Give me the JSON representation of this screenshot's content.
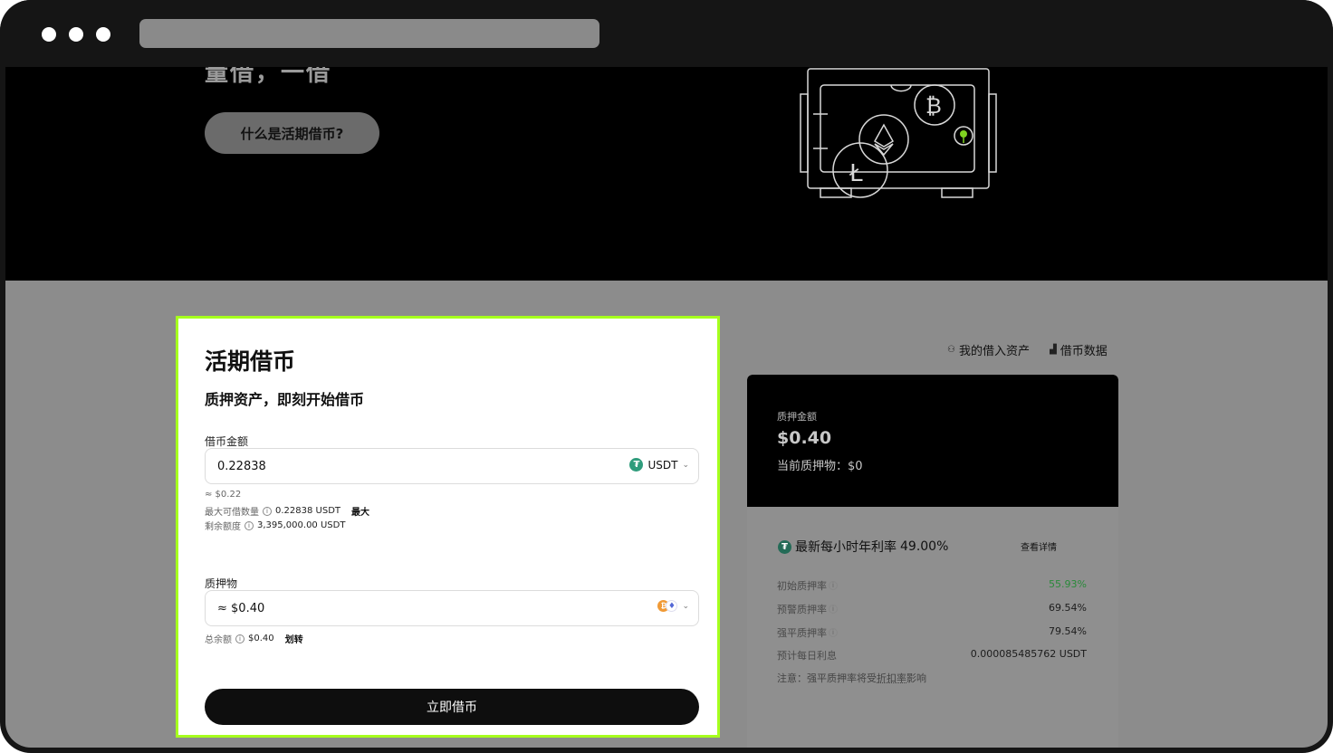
{
  "browser": {
    "url": ""
  },
  "hero": {
    "cut_text": "量借，一借",
    "what_is_button": "什么是活期借币?"
  },
  "borrow": {
    "title": "活期借币",
    "subtitle": "质押资产，即刻开始借币",
    "amount_label": "借币金额",
    "amount_value": "0.22838",
    "amount_coin": "USDT",
    "approx_value": "≈ $0.22",
    "max_label": "最大可借数量",
    "max_value": "0.22838 USDT",
    "max_button": "最大",
    "remaining_label": "剩余额度",
    "remaining_value": "3,395,000.00 USDT",
    "collateral_label": "质押物",
    "collateral_value": "≈ $0.40",
    "balance_label": "总余额",
    "balance_value": "$0.40",
    "transfer_link": "划转",
    "submit_button": "立即借币"
  },
  "links": {
    "my_borrowed": "我的借入资产",
    "borrow_data": "借币数据"
  },
  "summary": {
    "collateral_amount_label": "质押金额",
    "collateral_amount": "$0.40",
    "current_collateral": "当前质押物：$0",
    "rate_label": "最新每小时年利率",
    "rate_value": "49.00%",
    "details_link": "查看详情",
    "rows": [
      {
        "key": "初始质押率",
        "value": "55.93%",
        "info": true
      },
      {
        "key": "预警质押率",
        "value": "69.54%",
        "info": true
      },
      {
        "key": "强平质押率",
        "value": "79.54%",
        "info": true
      },
      {
        "key": "预计每日利息",
        "value": "0.000085485762 USDT",
        "info": false
      }
    ],
    "note_prefix": "注意：强平质押率将受",
    "note_link": "折扣率",
    "note_suffix": "影响"
  },
  "colors": {
    "highlight": "#a6ff1d",
    "usdt": "#2f9c7c",
    "green_value": "#2a8a3a",
    "btc": "#f09a36"
  },
  "icons": [
    "usdt-icon",
    "btc-icon",
    "eth-icon",
    "info-icon",
    "chevron-down-icon",
    "user-coin-icon",
    "chart-icon",
    "safe-illustration"
  ]
}
